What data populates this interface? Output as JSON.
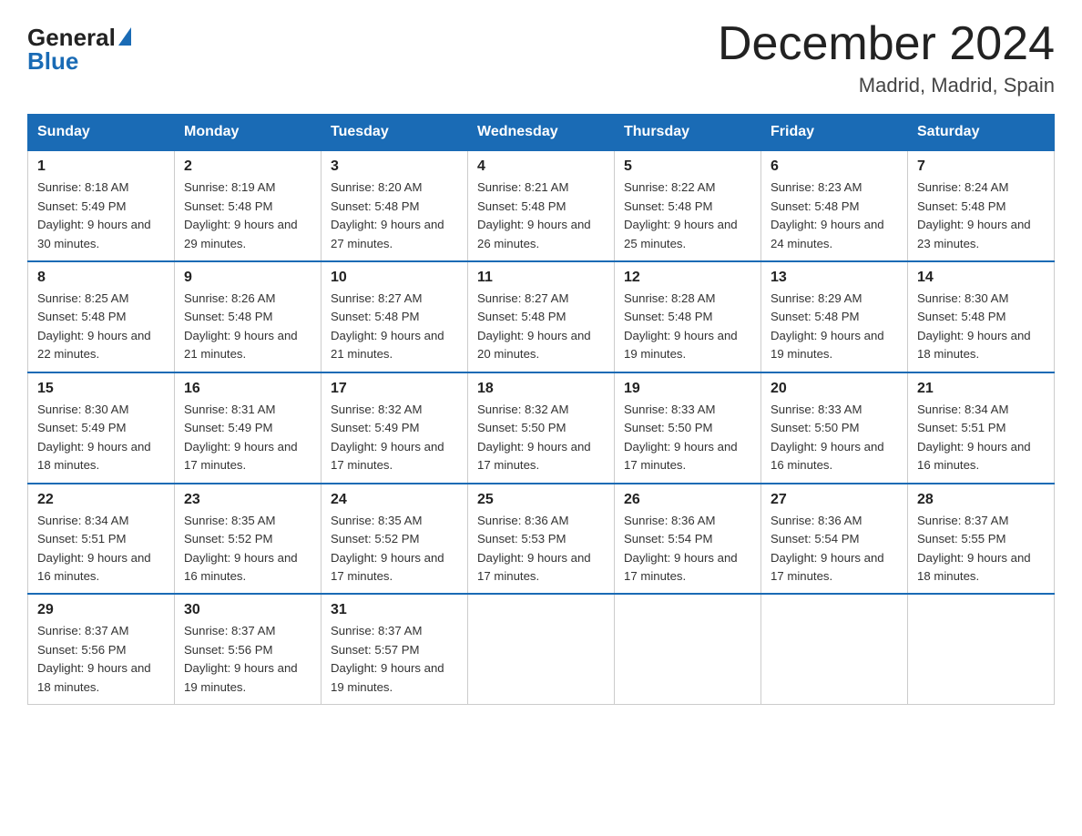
{
  "header": {
    "logo_general": "General",
    "logo_blue": "Blue",
    "title": "December 2024",
    "subtitle": "Madrid, Madrid, Spain"
  },
  "days_of_week": [
    "Sunday",
    "Monday",
    "Tuesday",
    "Wednesday",
    "Thursday",
    "Friday",
    "Saturday"
  ],
  "weeks": [
    [
      {
        "num": "1",
        "sunrise": "8:18 AM",
        "sunset": "5:49 PM",
        "daylight": "9 hours and 30 minutes."
      },
      {
        "num": "2",
        "sunrise": "8:19 AM",
        "sunset": "5:48 PM",
        "daylight": "9 hours and 29 minutes."
      },
      {
        "num": "3",
        "sunrise": "8:20 AM",
        "sunset": "5:48 PM",
        "daylight": "9 hours and 27 minutes."
      },
      {
        "num": "4",
        "sunrise": "8:21 AM",
        "sunset": "5:48 PM",
        "daylight": "9 hours and 26 minutes."
      },
      {
        "num": "5",
        "sunrise": "8:22 AM",
        "sunset": "5:48 PM",
        "daylight": "9 hours and 25 minutes."
      },
      {
        "num": "6",
        "sunrise": "8:23 AM",
        "sunset": "5:48 PM",
        "daylight": "9 hours and 24 minutes."
      },
      {
        "num": "7",
        "sunrise": "8:24 AM",
        "sunset": "5:48 PM",
        "daylight": "9 hours and 23 minutes."
      }
    ],
    [
      {
        "num": "8",
        "sunrise": "8:25 AM",
        "sunset": "5:48 PM",
        "daylight": "9 hours and 22 minutes."
      },
      {
        "num": "9",
        "sunrise": "8:26 AM",
        "sunset": "5:48 PM",
        "daylight": "9 hours and 21 minutes."
      },
      {
        "num": "10",
        "sunrise": "8:27 AM",
        "sunset": "5:48 PM",
        "daylight": "9 hours and 21 minutes."
      },
      {
        "num": "11",
        "sunrise": "8:27 AM",
        "sunset": "5:48 PM",
        "daylight": "9 hours and 20 minutes."
      },
      {
        "num": "12",
        "sunrise": "8:28 AM",
        "sunset": "5:48 PM",
        "daylight": "9 hours and 19 minutes."
      },
      {
        "num": "13",
        "sunrise": "8:29 AM",
        "sunset": "5:48 PM",
        "daylight": "9 hours and 19 minutes."
      },
      {
        "num": "14",
        "sunrise": "8:30 AM",
        "sunset": "5:48 PM",
        "daylight": "9 hours and 18 minutes."
      }
    ],
    [
      {
        "num": "15",
        "sunrise": "8:30 AM",
        "sunset": "5:49 PM",
        "daylight": "9 hours and 18 minutes."
      },
      {
        "num": "16",
        "sunrise": "8:31 AM",
        "sunset": "5:49 PM",
        "daylight": "9 hours and 17 minutes."
      },
      {
        "num": "17",
        "sunrise": "8:32 AM",
        "sunset": "5:49 PM",
        "daylight": "9 hours and 17 minutes."
      },
      {
        "num": "18",
        "sunrise": "8:32 AM",
        "sunset": "5:50 PM",
        "daylight": "9 hours and 17 minutes."
      },
      {
        "num": "19",
        "sunrise": "8:33 AM",
        "sunset": "5:50 PM",
        "daylight": "9 hours and 17 minutes."
      },
      {
        "num": "20",
        "sunrise": "8:33 AM",
        "sunset": "5:50 PM",
        "daylight": "9 hours and 16 minutes."
      },
      {
        "num": "21",
        "sunrise": "8:34 AM",
        "sunset": "5:51 PM",
        "daylight": "9 hours and 16 minutes."
      }
    ],
    [
      {
        "num": "22",
        "sunrise": "8:34 AM",
        "sunset": "5:51 PM",
        "daylight": "9 hours and 16 minutes."
      },
      {
        "num": "23",
        "sunrise": "8:35 AM",
        "sunset": "5:52 PM",
        "daylight": "9 hours and 16 minutes."
      },
      {
        "num": "24",
        "sunrise": "8:35 AM",
        "sunset": "5:52 PM",
        "daylight": "9 hours and 17 minutes."
      },
      {
        "num": "25",
        "sunrise": "8:36 AM",
        "sunset": "5:53 PM",
        "daylight": "9 hours and 17 minutes."
      },
      {
        "num": "26",
        "sunrise": "8:36 AM",
        "sunset": "5:54 PM",
        "daylight": "9 hours and 17 minutes."
      },
      {
        "num": "27",
        "sunrise": "8:36 AM",
        "sunset": "5:54 PM",
        "daylight": "9 hours and 17 minutes."
      },
      {
        "num": "28",
        "sunrise": "8:37 AM",
        "sunset": "5:55 PM",
        "daylight": "9 hours and 18 minutes."
      }
    ],
    [
      {
        "num": "29",
        "sunrise": "8:37 AM",
        "sunset": "5:56 PM",
        "daylight": "9 hours and 18 minutes."
      },
      {
        "num": "30",
        "sunrise": "8:37 AM",
        "sunset": "5:56 PM",
        "daylight": "9 hours and 19 minutes."
      },
      {
        "num": "31",
        "sunrise": "8:37 AM",
        "sunset": "5:57 PM",
        "daylight": "9 hours and 19 minutes."
      },
      null,
      null,
      null,
      null
    ]
  ]
}
